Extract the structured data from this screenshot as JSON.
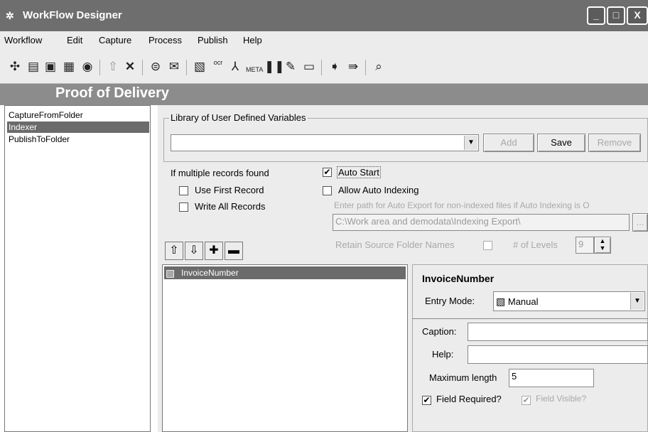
{
  "window": {
    "title": "WorkFlow Designer",
    "controls": [
      "_",
      "□",
      "X"
    ]
  },
  "menu": [
    "Workflow",
    "Edit",
    "Capture",
    "Process",
    "Publish",
    "Help"
  ],
  "toolbar_icons": [
    "new-icon",
    "open-icon",
    "save-icon",
    "save-as-icon",
    "lock-icon",
    "up-icon",
    "delete-icon",
    "capture-icon",
    "email-icon",
    "scan-icon",
    "ocr-icon",
    "pdf-icon",
    "meta-icon",
    "barcode-icon",
    "signature-icon",
    "image-icon",
    "publish-icon",
    "export-icon",
    "preview-icon"
  ],
  "banner": {
    "title": "Proof of Delivery"
  },
  "workflow_steps": [
    "CaptureFromFolder",
    "Indexer",
    "PublishToFolder"
  ],
  "selected_step": "Indexer",
  "library": {
    "legend": "Library of User Defined Variables",
    "value": "",
    "add": "Add",
    "save": "Save",
    "remove": "Remove"
  },
  "multiple_records": {
    "label": "If multiple records found",
    "use_first": "Use First Record",
    "use_first_checked": false,
    "write_all": "Write All Records",
    "write_all_checked": false
  },
  "auto": {
    "auto_start": "Auto Start",
    "auto_start_checked": true,
    "allow_auto_indexing": "Allow Auto Indexing",
    "allow_auto_indexing_checked": false,
    "export_hint": "Enter path for Auto Export for non-indexed files if Auto Indexing is O",
    "export_path": "C:\\Work area and demodata\\Indexing Export\\",
    "browse": "...",
    "retain_label": "Retain Source Folder Names",
    "levels_label": "# of Levels",
    "levels_value": "9"
  },
  "list_buttons": [
    "⇧",
    "⇩",
    "✚",
    "▬"
  ],
  "fields": [
    "InvoiceNumber"
  ],
  "field_props": {
    "name": "InvoiceNumber",
    "entry_mode_label": "Entry Mode:",
    "entry_mode": "Manual",
    "caption_label": "Caption:",
    "caption_value": "",
    "help_label": "Help:",
    "help_value": "",
    "maxlen_label": "Maximum length",
    "maxlen_value": "5",
    "required_label": "Field Required?",
    "required_checked": true,
    "visible_label": "Field Visible?",
    "visible_checked": true
  }
}
